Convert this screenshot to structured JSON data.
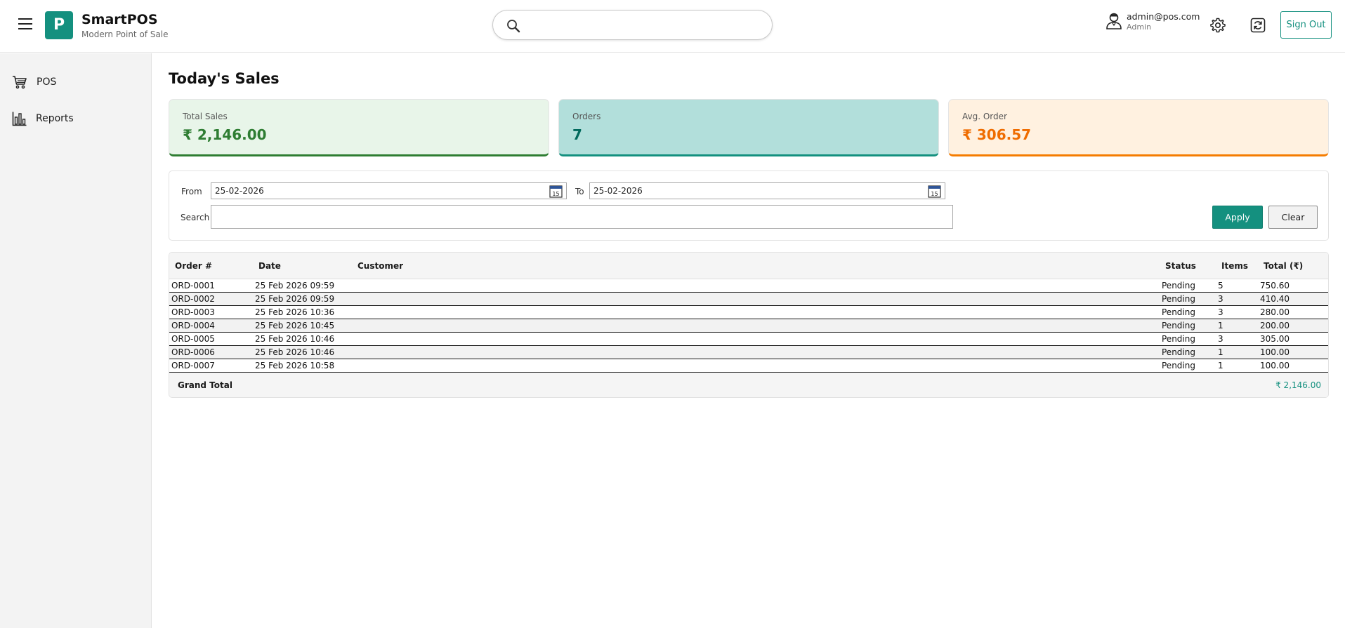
{
  "header": {
    "brand_letter": "P",
    "brand_title": "SmartPOS",
    "brand_subtitle": "Modern Point of Sale",
    "search_placeholder": "",
    "user_email": "admin@pos.com",
    "user_role": "Admin",
    "signout_label": "Sign Out"
  },
  "sidebar": {
    "items": [
      {
        "label": "POS",
        "icon": "shopping-cart-icon"
      },
      {
        "label": "Reports",
        "icon": "bar-chart-icon"
      }
    ]
  },
  "main": {
    "title": "Today's Sales",
    "cards": {
      "sales": {
        "label": "Total Sales",
        "value": "₹ 2,146.00",
        "color": "#2e7d32"
      },
      "orders": {
        "label": "Orders",
        "value": "7",
        "color": "#14907f"
      },
      "avg": {
        "label": "Avg. Order",
        "value": "₹ 306.57",
        "color": "#f57c00"
      }
    },
    "filters": {
      "from_label": "From",
      "from_value": "25-02-2026",
      "to_label": "To",
      "to_value": "25-02-2026",
      "search_label": "Search",
      "search_value": "",
      "apply_label": "Apply",
      "clear_label": "Clear"
    },
    "table": {
      "columns": {
        "order": "Order #",
        "date": "Date",
        "customer": "Customer",
        "status": "Status",
        "items": "Items",
        "total": "Total (₹)"
      },
      "rows": [
        {
          "order": "ORD-0001",
          "date": "25 Feb 2026 09:59",
          "customer": "",
          "status": "Pending",
          "items": "5",
          "total": "750.60"
        },
        {
          "order": "ORD-0002",
          "date": "25 Feb 2026 09:59",
          "customer": "",
          "status": "Pending",
          "items": "3",
          "total": "410.40"
        },
        {
          "order": "ORD-0003",
          "date": "25 Feb 2026 10:36",
          "customer": "",
          "status": "Pending",
          "items": "3",
          "total": "280.00"
        },
        {
          "order": "ORD-0004",
          "date": "25 Feb 2026 10:45",
          "customer": "",
          "status": "Pending",
          "items": "1",
          "total": "200.00"
        },
        {
          "order": "ORD-0005",
          "date": "25 Feb 2026 10:46",
          "customer": "",
          "status": "Pending",
          "items": "3",
          "total": "305.00"
        },
        {
          "order": "ORD-0006",
          "date": "25 Feb 2026 10:46",
          "customer": "",
          "status": "Pending",
          "items": "1",
          "total": "100.00"
        },
        {
          "order": "ORD-0007",
          "date": "25 Feb 2026 10:58",
          "customer": "",
          "status": "Pending",
          "items": "1",
          "total": "100.00"
        }
      ],
      "grand_total_label": "Grand Total",
      "grand_total_value": "₹ 2,146.00"
    }
  },
  "colors": {
    "accent": "#14907f"
  }
}
